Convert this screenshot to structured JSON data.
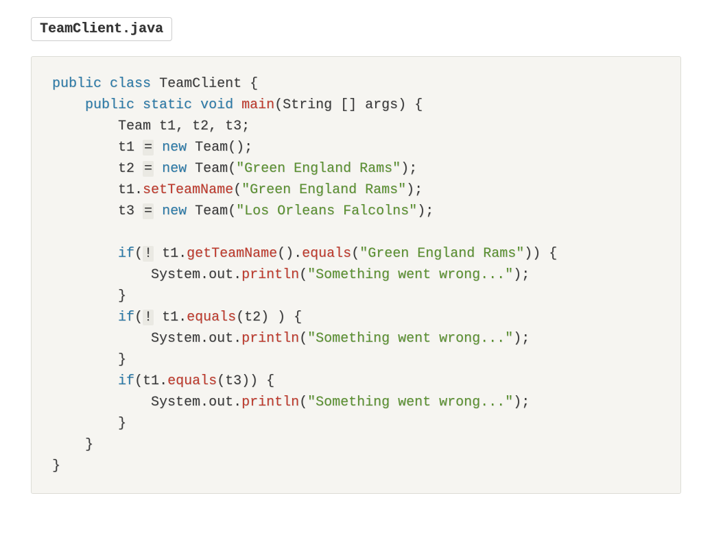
{
  "file": {
    "name": "TeamClient.java"
  },
  "code": {
    "kw_public": "public",
    "kw_class": "class",
    "kw_static": "static",
    "kw_void": "void",
    "kw_new": "new",
    "kw_if": "if",
    "cls_TeamClient": "TeamClient",
    "id_main": "main",
    "id_String": "String",
    "id_args": "args",
    "id_Team": "Team",
    "id_t1": "t1",
    "id_t2": "t2",
    "id_t3": "t3",
    "m_setTeamName": "setTeamName",
    "m_getTeamName": "getTeamName",
    "m_equals": "equals",
    "m_println": "println",
    "id_System": "System",
    "id_out": "out",
    "str_green": "\"Green England Rams\"",
    "str_los": "\"Los Orleans Falcolns\"",
    "str_wrong": "\"Something went wrong...\"",
    "op_assign": "=",
    "op_bang": "!",
    "p_lbrace": "{",
    "p_rbrace": "}",
    "p_lparen": "(",
    "p_rparen": "(",
    "p_lbracket": "[]",
    "p_semi": ";",
    "p_comma": ",",
    "p_dot": "."
  }
}
